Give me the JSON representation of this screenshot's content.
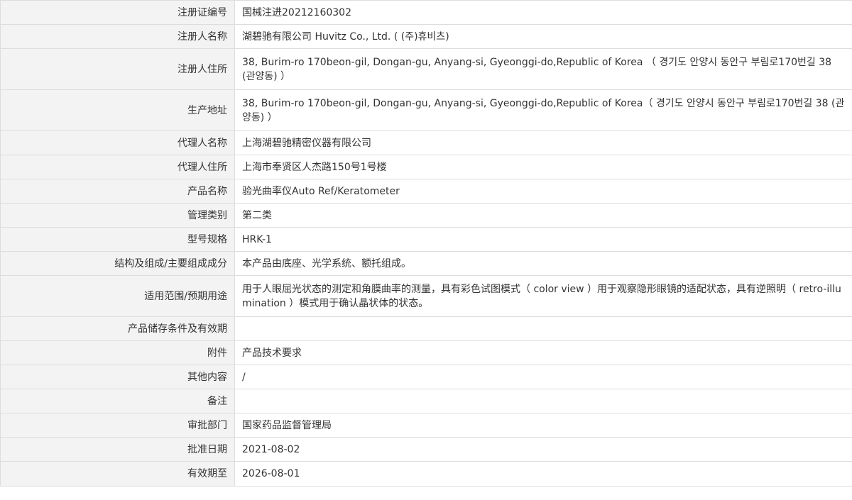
{
  "rows": [
    {
      "label": "注册证编号",
      "value": "国械注进20212160302"
    },
    {
      "label": "注册人名称",
      "value": "湖碧驰有限公司 Huvitz Co., Ltd. ( (주)휴비츠)"
    },
    {
      "label": "注册人住所",
      "value": "38, Burim-ro 170beon-gil, Dongan-gu, Anyang-si, Gyeonggi-do,Republic of Korea （ 경기도 안양시 동안구 부림로170번길 38 (관양동) ）"
    },
    {
      "label": "生产地址",
      "value": "38, Burim-ro 170beon-gil, Dongan-gu, Anyang-si, Gyeonggi-do,Republic of Korea（ 경기도 안양시 동안구 부림로170번길 38 (관양동) ）"
    },
    {
      "label": "代理人名称",
      "value": "上海湖碧驰精密仪器有限公司"
    },
    {
      "label": "代理人住所",
      "value": "上海市奉贤区人杰路150号1号楼"
    },
    {
      "label": "产品名称",
      "value": "验光曲率仪Auto Ref/Keratometer"
    },
    {
      "label": "管理类别",
      "value": "第二类"
    },
    {
      "label": "型号规格",
      "value": "HRK-1"
    },
    {
      "label": "结构及组成/主要组成成分",
      "value": "本产品由底座、光学系统、额托组成。"
    },
    {
      "label": "适用范围/预期用途",
      "value": "用于人眼屈光状态的测定和角膜曲率的测量，具有彩色试图模式（ color view ）用于观察隐形眼镜的适配状态，具有逆照明（ retro-illumination ）模式用于确认晶状体的状态。"
    },
    {
      "label": "产品储存条件及有效期",
      "value": ""
    },
    {
      "label": "附件",
      "value": "产品技术要求"
    },
    {
      "label": "其他内容",
      "value": "/"
    },
    {
      "label": "备注",
      "value": ""
    },
    {
      "label": "审批部门",
      "value": "国家药品监督管理局"
    },
    {
      "label": "批准日期",
      "value": "2021-08-02"
    },
    {
      "label": "有效期至",
      "value": "2026-08-01"
    }
  ]
}
